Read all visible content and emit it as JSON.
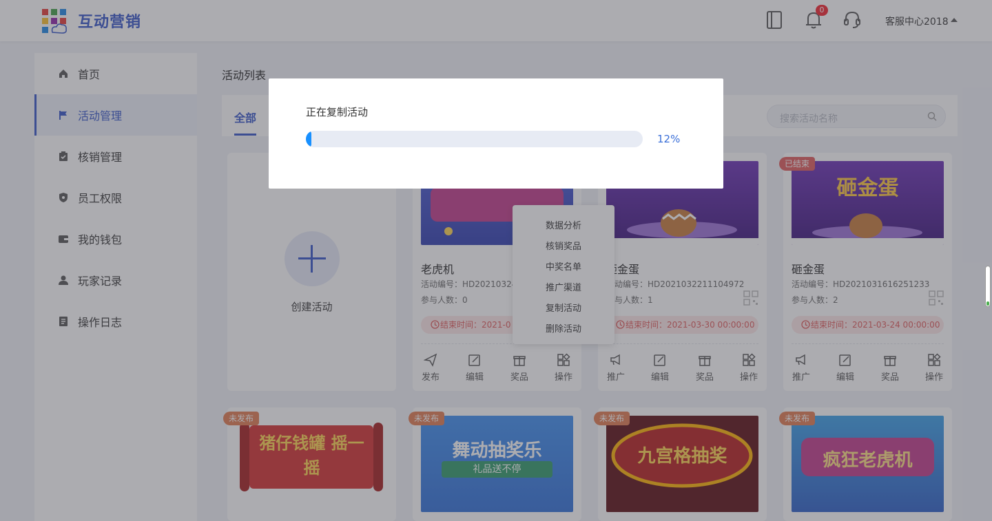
{
  "header": {
    "app_title": "互动营销",
    "notification_count": "0",
    "user_name": "客服中心2018"
  },
  "sidebar": {
    "items": [
      {
        "label": "首页",
        "icon": "home-icon"
      },
      {
        "label": "活动管理",
        "icon": "flag-icon"
      },
      {
        "label": "核销管理",
        "icon": "clipboard-check-icon"
      },
      {
        "label": "员工权限",
        "icon": "shield-icon"
      },
      {
        "label": "我的钱包",
        "icon": "wallet-icon"
      },
      {
        "label": "玩家记录",
        "icon": "user-icon"
      },
      {
        "label": "操作日志",
        "icon": "document-icon"
      }
    ],
    "active_index": 1
  },
  "main": {
    "page_title": "活动列表",
    "tab_all": "全部",
    "search_placeholder": "搜索活动名称",
    "create_label": "创建活动",
    "cards": [
      {
        "name": "老虎机",
        "code": "活动编号：HD20210324",
        "participants": "参与人数：0",
        "end_time": "结束时间：2021-0",
        "actions": [
          "发布",
          "编辑",
          "奖品",
          "操作"
        ]
      },
      {
        "name": "砸金蛋",
        "code": "活动编号：HD2021032211104972",
        "participants": "参与人数：1",
        "end_time": "结束时间：2021-03-30 00:00:00",
        "actions": [
          "推广",
          "编辑",
          "奖品",
          "操作"
        ]
      },
      {
        "tag": "已结束",
        "thumb_text": "砸金蛋",
        "name": "砸金蛋",
        "code": "活动编号：HD2021031616251233",
        "participants": "参与人数：2",
        "end_time": "结束时间：2021-03-24 00:00:00",
        "actions": [
          "推广",
          "编辑",
          "奖品",
          "操作"
        ]
      }
    ],
    "bottom_cards": [
      {
        "tag": "未发布",
        "thumb_text": "猪仔钱罐 摇一摇"
      },
      {
        "tag": "未发布",
        "thumb_text": "舞动抽奖乐",
        "sub_text": "礼品送不停"
      },
      {
        "tag": "未发布",
        "thumb_text": "九宫格抽奖"
      },
      {
        "tag": "未发布",
        "thumb_text": "疯狂老虎机"
      }
    ],
    "dropdown": [
      "数据分析",
      "核销奖品",
      "中奖名单",
      "推广渠道",
      "复制活动",
      "删除活动"
    ]
  },
  "modal": {
    "title": "正在复制活动",
    "progress": 0.012,
    "progress_text": "12%"
  },
  "colors": {
    "brand": "#3455c9",
    "progress": "#1890ff",
    "danger": "#e05a5a"
  }
}
